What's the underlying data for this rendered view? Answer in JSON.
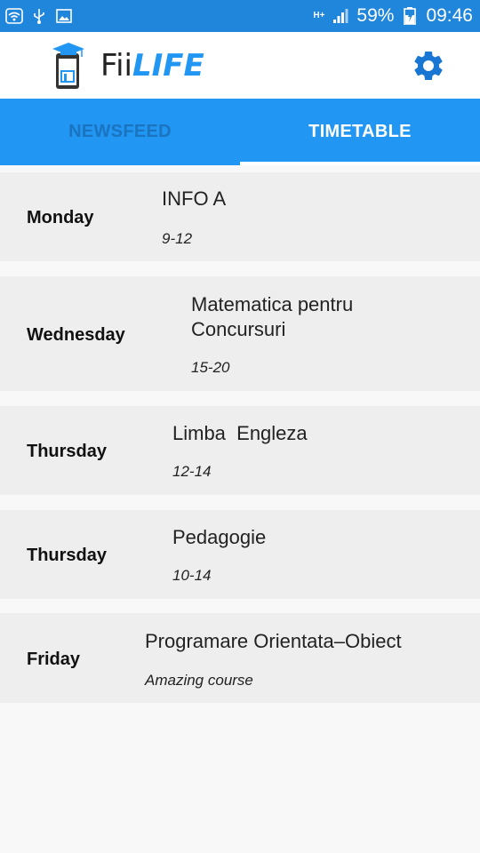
{
  "status_bar": {
    "network": "H+",
    "battery": "59%",
    "time": "09:46",
    "icons": [
      "wifi-icon",
      "usb-icon",
      "image-icon",
      "signal-icon",
      "battery-charging-icon"
    ]
  },
  "app": {
    "name_prefix": "Fii",
    "name_accent": "LIFE",
    "accent_color": "#2196f3",
    "settings_icon": "gear-icon"
  },
  "tabs": [
    {
      "label": "NEWSFEED",
      "active": false
    },
    {
      "label": "TIMETABLE",
      "active": true
    }
  ],
  "timetable": [
    {
      "day": "Monday",
      "course": "INFO A",
      "time": "9-12"
    },
    {
      "day": "Wednesday",
      "course": "Matematica pentru Concursuri",
      "time": "15-20"
    },
    {
      "day": "Thursday",
      "course": "Limba  Engleza",
      "time": "12-14"
    },
    {
      "day": "Thursday",
      "course": "Pedagogie",
      "time": "10-14"
    },
    {
      "day": "Friday",
      "course": "Programare Orientata–Obiect",
      "time": "Amazing course"
    }
  ]
}
